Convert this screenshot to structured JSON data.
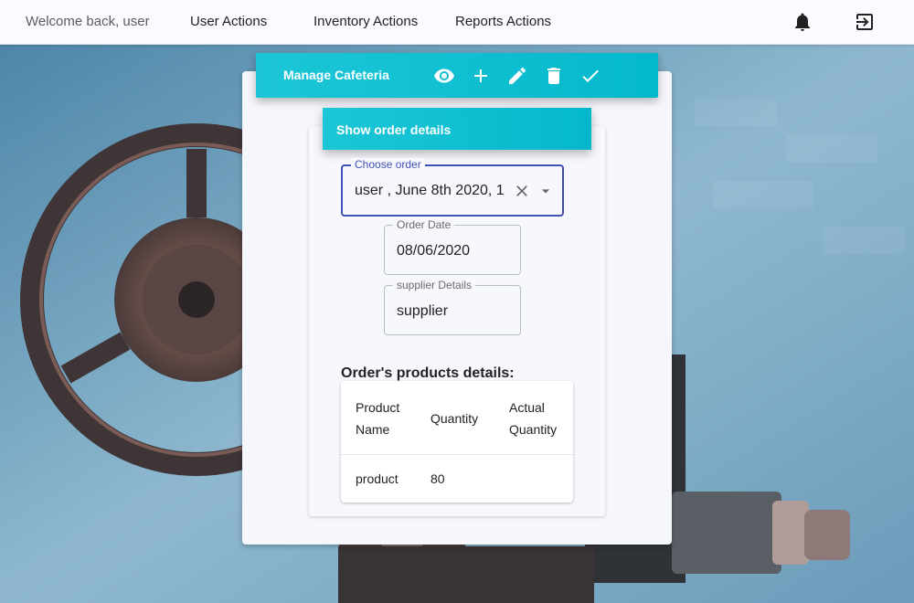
{
  "topbar": {
    "welcome": "Welcome back, user",
    "nav": {
      "user_actions": "User Actions",
      "inventory_actions": "Inventory Actions",
      "reports_actions": "Reports Actions"
    },
    "icons": [
      "bell-icon",
      "exit-icon"
    ]
  },
  "toolbar": {
    "title": "Manage Cafeteria",
    "icons": [
      "eye-icon",
      "add-icon",
      "edit-icon",
      "delete-icon",
      "check-icon"
    ]
  },
  "subheader": {
    "title": "Show order details"
  },
  "order_select": {
    "label": "Choose order",
    "value": "user , June 8th 2020, 1"
  },
  "order_date": {
    "label": "Order Date",
    "value": "08/06/2020"
  },
  "supplier": {
    "label": "supplier Details",
    "value": "supplier"
  },
  "products": {
    "title": "Order's products details:",
    "columns": [
      "Product Name",
      "Quantity",
      "Actual Quantity"
    ],
    "rows": [
      {
        "name": "product",
        "quantity": "80",
        "actual_quantity": ""
      }
    ]
  },
  "colors": {
    "accent": "#04b8cc",
    "focus": "#3f51b5",
    "topbar_bg": "#fafbfe"
  }
}
